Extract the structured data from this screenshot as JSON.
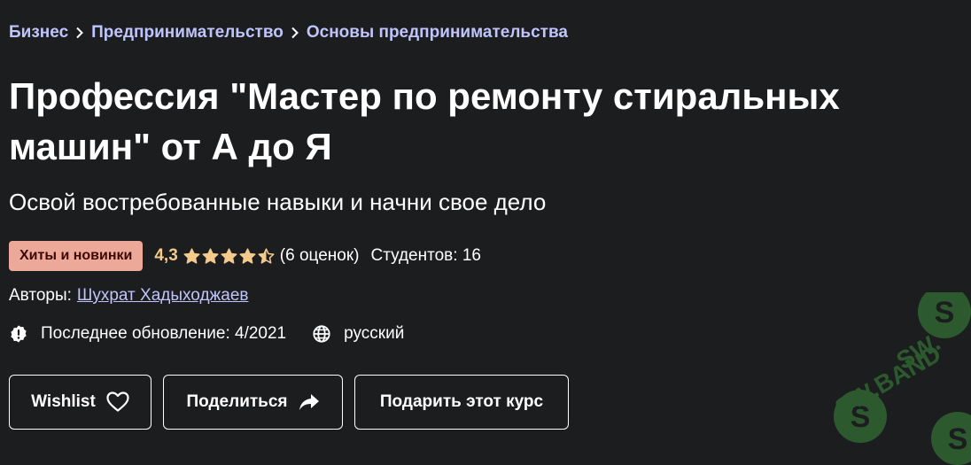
{
  "breadcrumb": {
    "items": [
      {
        "label": "Бизнес"
      },
      {
        "label": "Предпринимательство"
      },
      {
        "label": "Основы предпринимательства"
      }
    ]
  },
  "course": {
    "title": "Профессия \"Мастер по ремонту стиральных машин\" от А до Я",
    "subtitle": "Освой востребованные навыки и начни свое дело",
    "badge": "Хиты и новинки",
    "rating": "4,3",
    "rating_value": 4.3,
    "rating_max": 5,
    "ratings_count": "(6 оценок)",
    "students": "Студентов: 16",
    "authors_label": "Авторы:",
    "author": "Шухрат Хадыходжаев",
    "last_updated": "Последнее обновление: 4/2021",
    "language": "русский"
  },
  "actions": {
    "wishlist": "Wishlist",
    "share": "Поделиться",
    "gift": "Подарить этот курс"
  },
  "watermark": {
    "text": "SW.BAND"
  },
  "colors": {
    "background": "#1c1d1f",
    "link": "#c0c4fc",
    "rating": "#f3ca8c",
    "badge_bg": "#eca898",
    "badge_text": "#3d0801",
    "watermark": "#3a8a3a"
  },
  "icons": [
    "chevron-right-icon",
    "star-icon",
    "half-star-icon",
    "alert-badge-icon",
    "globe-icon",
    "heart-icon",
    "share-arrow-icon"
  ]
}
